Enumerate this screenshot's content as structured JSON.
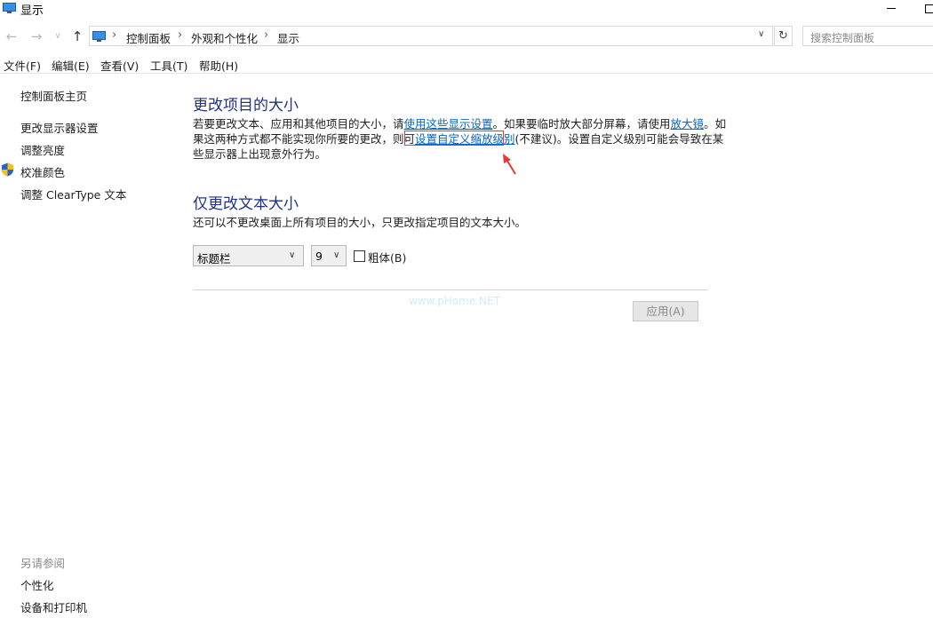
{
  "window": {
    "title": "显示"
  },
  "address": {
    "crumbs": [
      "控制面板",
      "外观和个性化",
      "显示"
    ],
    "search_placeholder": "搜索控制面板"
  },
  "nav": {
    "back": "←",
    "forward": "→",
    "recent": "∨",
    "up": "↑",
    "refresh": "↻",
    "dropdown": "∨",
    "separator": "›"
  },
  "menu": [
    "文件(F)",
    "编辑(E)",
    "查看(V)",
    "工具(T)",
    "帮助(H)"
  ],
  "sidebar": {
    "home": "控制面板主页",
    "links": [
      "更改显示器设置",
      "调整亮度",
      "校准颜色",
      "调整 ClearType 文本"
    ],
    "see_also_heading": "另请参阅",
    "see_also": [
      "个性化",
      "设备和打印机"
    ]
  },
  "section1": {
    "heading": "更改项目的大小",
    "line1_a": "若要更改文本、应用和其他项目的大小，请",
    "link_display_settings": "使用这些显示设置",
    "line1_b": "。如果要临时放大部分屏幕，请使用",
    "link_magnifier": "放大镜",
    "line1_c": "。如",
    "line2_a": "果这两种方式都不能实现你所要的更改，则可",
    "link_custom_scaling": "设置自定义缩放级别",
    "line2_b": "(不建议)。设置自定义级别可能会导致在某",
    "line3": "些显示器上出现意外行为。"
  },
  "section2": {
    "heading": "仅更改文本大小",
    "description": "还可以不更改桌面上所有项目的大小，只更改指定项目的文本大小。",
    "item_select_value": "标题栏",
    "size_select_value": "9",
    "bold_label": "粗体(B)",
    "bold_checked": false,
    "watermark": "www.pHome.NET",
    "apply_button": "应用(A)"
  },
  "colors": {
    "heading": "#1e3287",
    "link": "#0066cc",
    "highlight": "#e53935"
  },
  "icons": {
    "title": "monitor-icon",
    "calibrate": "shield-icon",
    "annotation": "red-arrow-icon"
  }
}
